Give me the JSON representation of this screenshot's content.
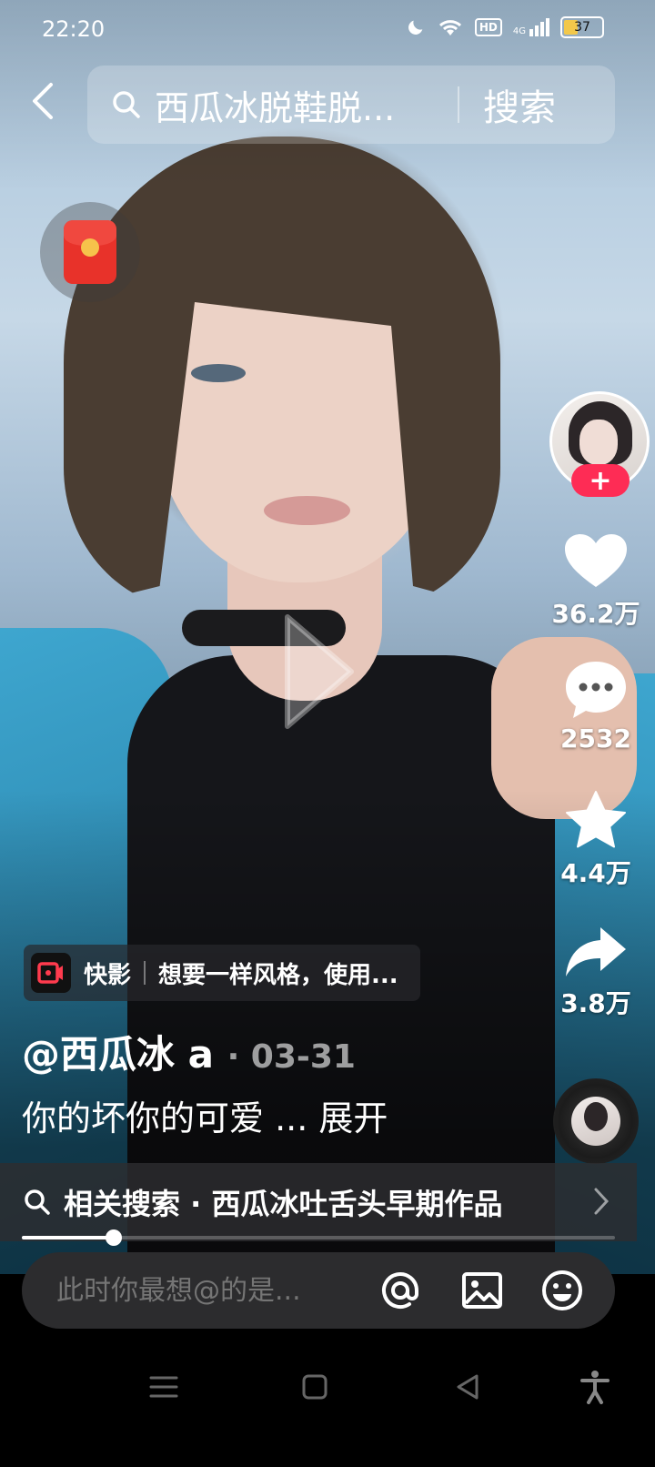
{
  "status_bar": {
    "time": "22:20",
    "hd": "HD",
    "network": "4G",
    "battery": "37",
    "battery_fraction": 0.37
  },
  "search": {
    "query": "西瓜冰脱鞋脱...",
    "button_label": "搜索"
  },
  "icons": {
    "back": "back-arrow-icon",
    "search": "search-icon",
    "red_packet": "red-packet-icon",
    "play": "play-icon",
    "like": "heart-icon",
    "comment": "comment-bubble-icon",
    "favorite": "star-icon",
    "share": "share-arrow-icon",
    "music": "music-disc-icon",
    "mention": "at-icon",
    "image": "image-icon",
    "emoji": "emoji-icon"
  },
  "rail": {
    "follow_label": "+",
    "likes": "36.2万",
    "comments": "2532",
    "favorites": "4.4万",
    "shares": "3.8万"
  },
  "effect_tag": {
    "name": "快影",
    "description": "想要一样风格，使用..."
  },
  "post": {
    "author": "@西瓜冰 a",
    "date": "· 03-31",
    "caption": "你的坏你的可爱 ...",
    "expand_label": "展开"
  },
  "related_search": {
    "text": "相关搜索 · 西瓜冰吐舌头早期作品"
  },
  "progress": {
    "fraction": 0.155
  },
  "comment_bar": {
    "placeholder": "此时你最想@的是..."
  },
  "colors": {
    "follow_button": "#fe2c55",
    "red_packet": "#e8322a",
    "like_heart": "#ffffff"
  }
}
